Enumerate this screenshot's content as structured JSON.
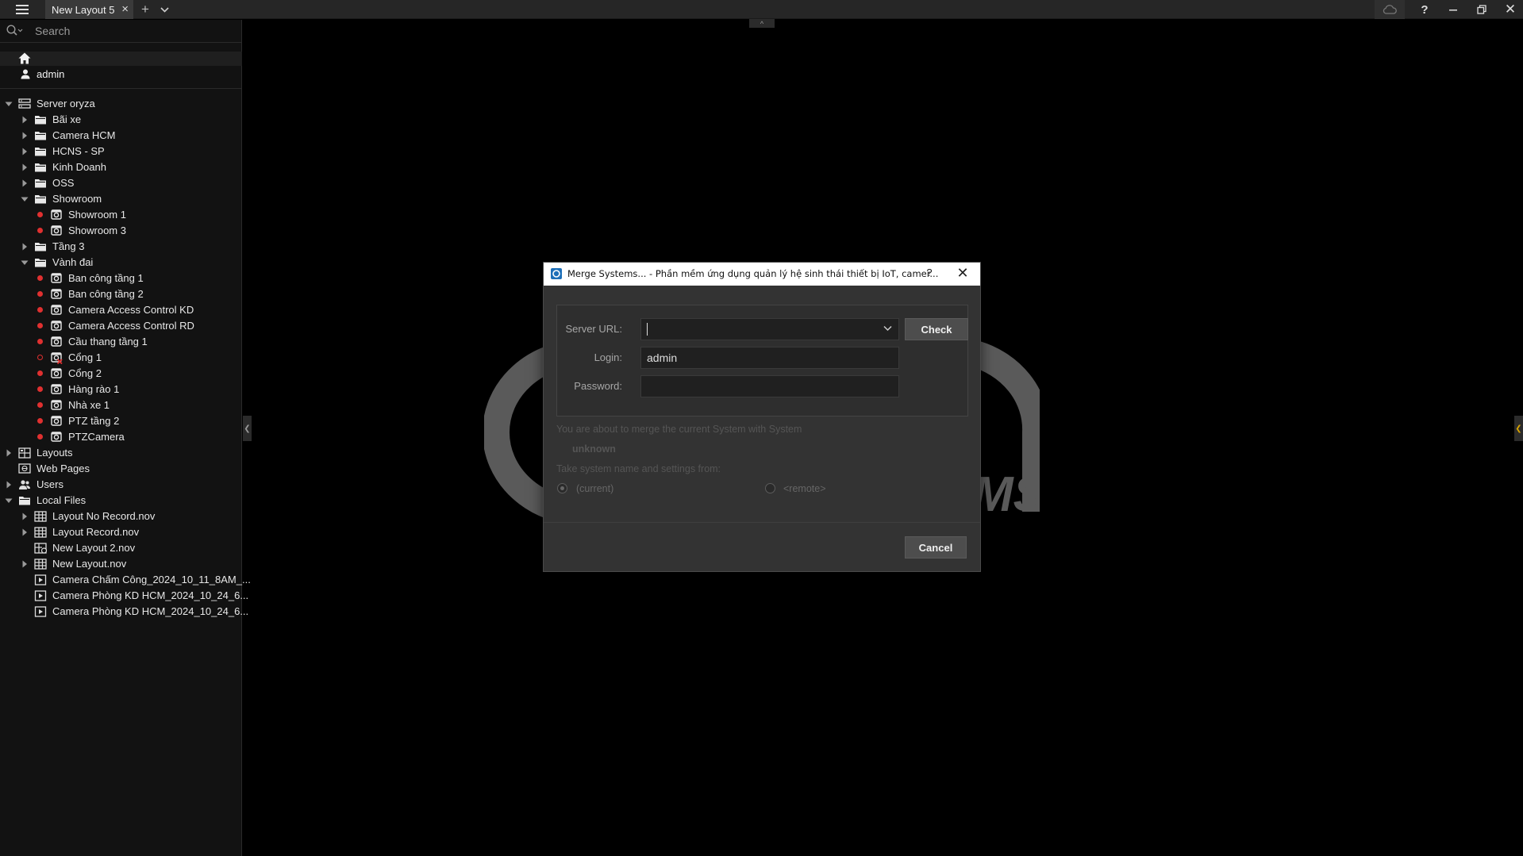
{
  "titlebar": {
    "tab_label": "New Layout 5",
    "tab_close": "×",
    "add_tab": "+",
    "help": "?",
    "close": "✕"
  },
  "search": {
    "placeholder": "Search"
  },
  "user": {
    "name": "admin"
  },
  "tree": [
    {
      "label": "Server oryza",
      "level": 0,
      "arrow": "down",
      "icon": "server-icon"
    },
    {
      "label": "Bãi xe",
      "level": 1,
      "arrow": "right",
      "icon": "folder-icon"
    },
    {
      "label": "Camera HCM",
      "level": 1,
      "arrow": "right",
      "icon": "folder-icon"
    },
    {
      "label": "HCNS - SP",
      "level": 1,
      "arrow": "right",
      "icon": "folder-icon"
    },
    {
      "label": "Kinh Doanh",
      "level": 1,
      "arrow": "right",
      "icon": "folder-icon"
    },
    {
      "label": "OSS",
      "level": 1,
      "arrow": "right",
      "icon": "folder-icon"
    },
    {
      "label": "Showroom",
      "level": 1,
      "arrow": "down",
      "icon": "folder-icon"
    },
    {
      "label": "Showroom 1",
      "level": 2,
      "dot": "red",
      "icon": "camera-icon"
    },
    {
      "label": "Showroom 3",
      "level": 2,
      "dot": "red",
      "icon": "camera-icon"
    },
    {
      "label": "Tầng 3",
      "level": 1,
      "arrow": "right",
      "icon": "folder-icon"
    },
    {
      "label": "Vành đai",
      "level": 1,
      "arrow": "down",
      "icon": "folder-icon"
    },
    {
      "label": "Ban công tầng 1",
      "level": 2,
      "dot": "red",
      "icon": "camera-icon"
    },
    {
      "label": "Ban công tầng 2",
      "level": 2,
      "dot": "red",
      "icon": "camera-icon"
    },
    {
      "label": "Camera Access Control KD",
      "level": 2,
      "dot": "red",
      "icon": "camera-icon"
    },
    {
      "label": "Camera Access Control RD",
      "level": 2,
      "dot": "red",
      "icon": "camera-icon"
    },
    {
      "label": "Cầu thang tầng 1",
      "level": 2,
      "dot": "red",
      "icon": "camera-icon"
    },
    {
      "label": "Cổng 1",
      "level": 2,
      "dot": "red-hollow",
      "icon": "camera-error-icon"
    },
    {
      "label": "Cổng 2",
      "level": 2,
      "dot": "red",
      "icon": "camera-icon"
    },
    {
      "label": "Hàng rào 1",
      "level": 2,
      "dot": "red",
      "icon": "camera-icon"
    },
    {
      "label": "Nhà xe 1",
      "level": 2,
      "dot": "red",
      "icon": "camera-icon"
    },
    {
      "label": "PTZ tầng 2",
      "level": 2,
      "dot": "red",
      "icon": "camera-icon"
    },
    {
      "label": "PTZCamera",
      "level": 2,
      "dot": "red",
      "icon": "camera-icon"
    },
    {
      "label": "Layouts",
      "level": 0,
      "arrow": "right",
      "icon": "layouts-icon"
    },
    {
      "label": "Web Pages",
      "level": 0,
      "icon": "web-pages-icon"
    },
    {
      "label": "Users",
      "level": 0,
      "arrow": "right",
      "icon": "users-icon"
    },
    {
      "label": "Local Files",
      "level": 0,
      "arrow": "down",
      "icon": "folder-icon"
    },
    {
      "label": "Layout No Record.nov",
      "level": 1,
      "arrow": "right",
      "icon": "layout-file-icon"
    },
    {
      "label": "Layout Record.nov",
      "level": 1,
      "arrow": "right",
      "icon": "layout-file-icon"
    },
    {
      "label": "New Layout 2.nov",
      "level": 1,
      "icon": "layout-file-locked-icon"
    },
    {
      "label": "New Layout.nov",
      "level": 1,
      "arrow": "right",
      "icon": "layout-file-icon"
    },
    {
      "label": "Camera Chấm Công_2024_10_11_8AM_...",
      "level": 1,
      "icon": "video-file-icon"
    },
    {
      "label": "Camera Phòng KD HCM_2024_10_24_6...",
      "level": 1,
      "icon": "video-file-icon"
    },
    {
      "label": "Camera Phòng KD HCM_2024_10_24_6...",
      "level": 1,
      "icon": "video-file-icon"
    }
  ],
  "dialog": {
    "title": "Merge Systems... - Phần mềm ứng dụng quản lý hệ sinh thái thiết bị IoT, camer...",
    "help": "?",
    "close": "✕",
    "server_url_label": "Server URL:",
    "server_url_value": "",
    "check_label": "Check",
    "login_label": "Login:",
    "login_value": "admin",
    "password_label": "Password:",
    "password_value": "",
    "merge_text": "You are about to merge the current System  with System",
    "unknown_text": "unknown",
    "take_text": "Take system name and settings from:",
    "option_current": "(current)",
    "option_remote": "<remote>",
    "cancel_label": "Cancel"
  },
  "colors": {
    "status_red": "#e03030",
    "accent_blue": "#1d6fb8",
    "collapse_accent": "#d8a400"
  }
}
